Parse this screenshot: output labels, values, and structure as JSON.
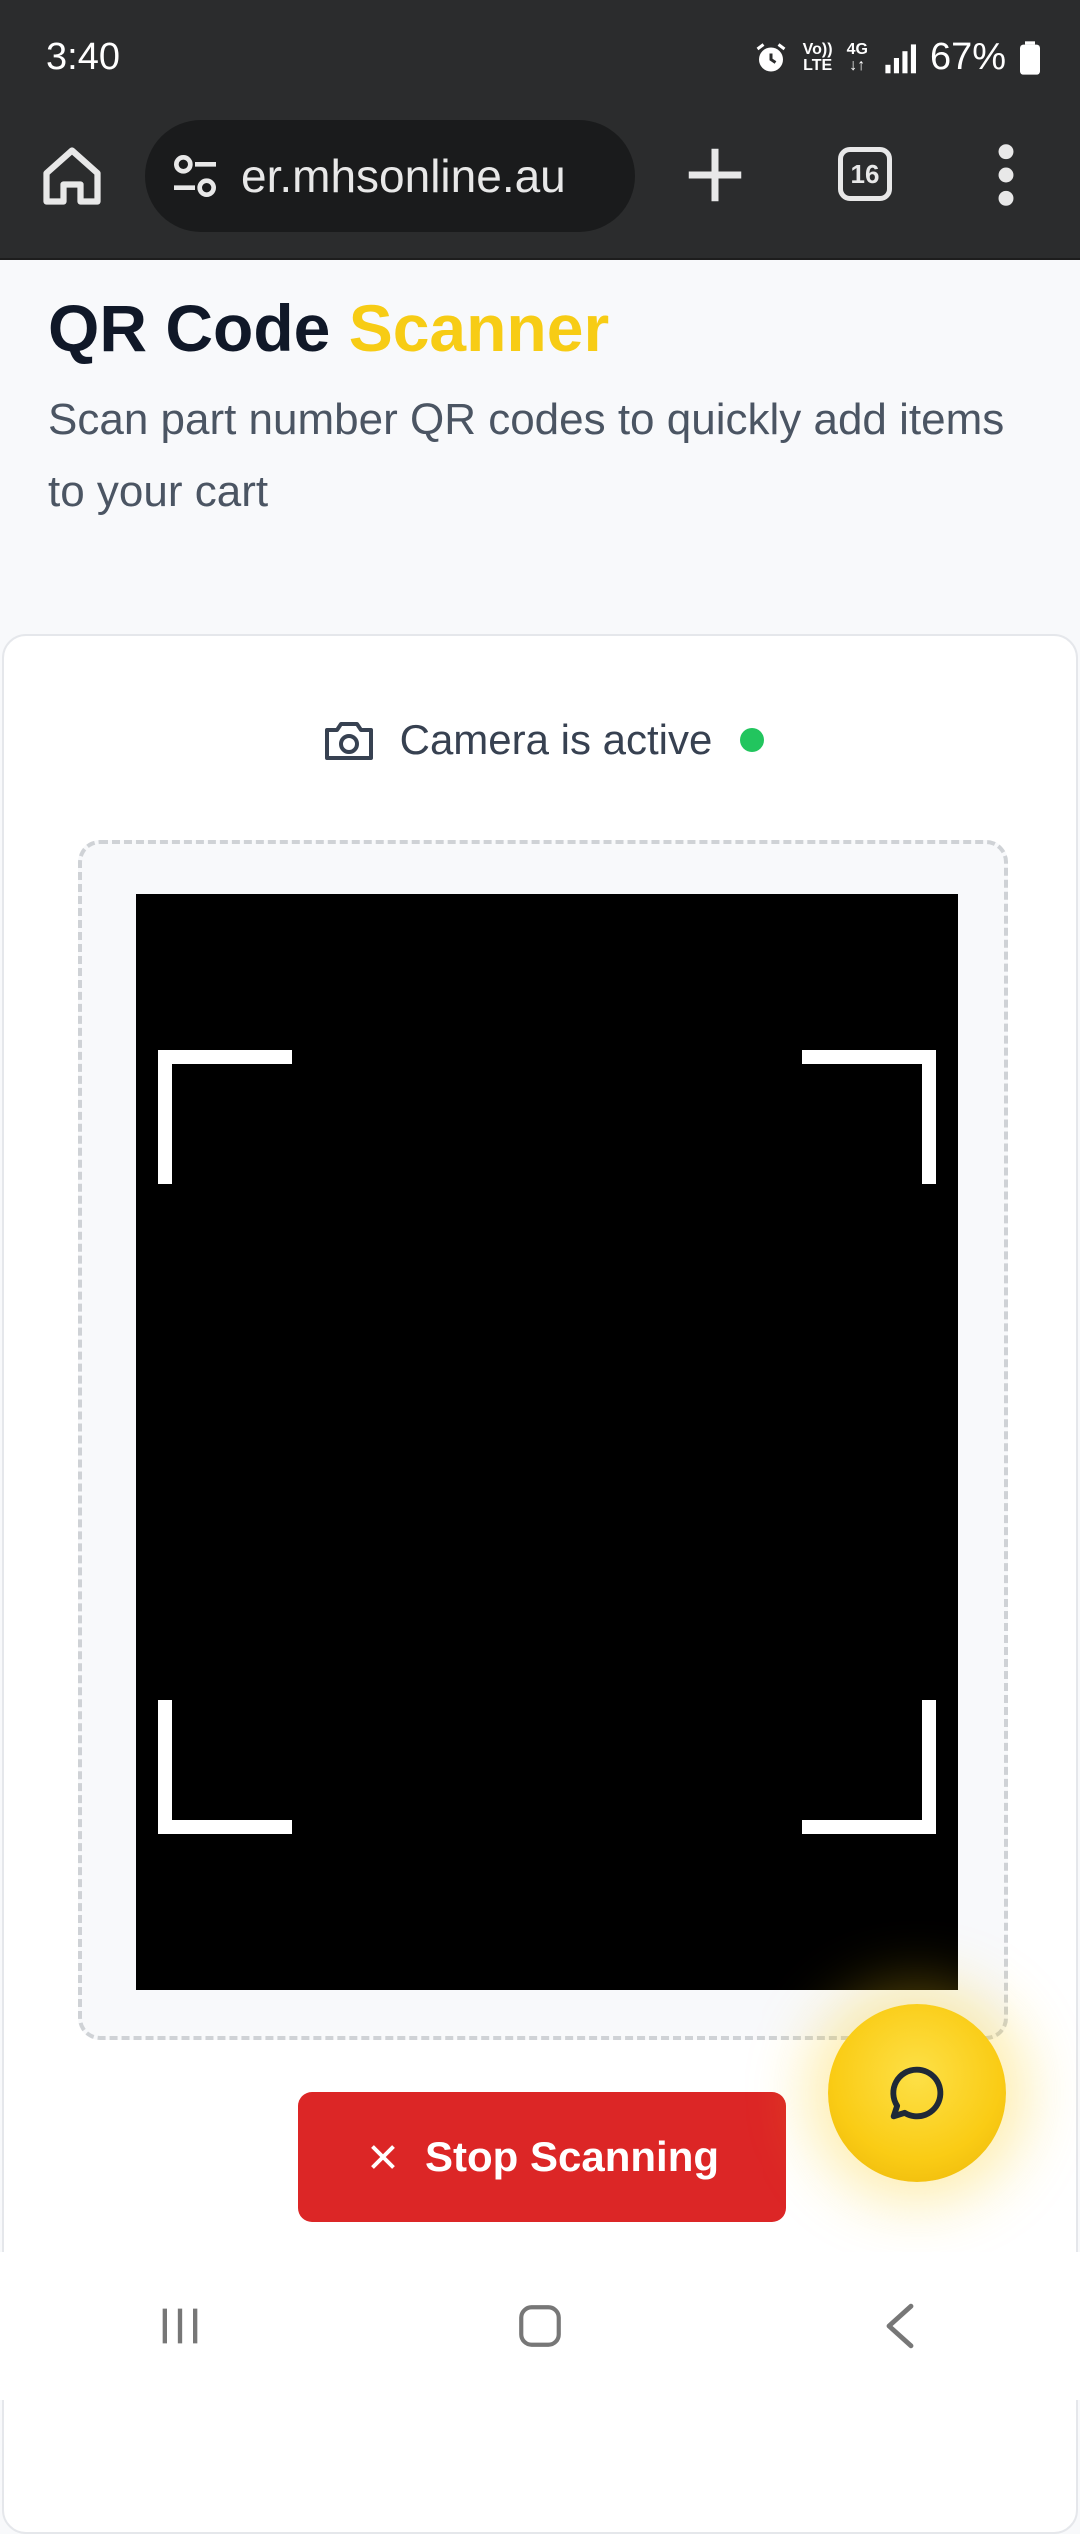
{
  "status_bar": {
    "time": "3:40",
    "volte_label_top": "Vo))",
    "volte_label_bottom": "LTE",
    "network_label": "4G",
    "battery": "67%"
  },
  "browser": {
    "url": "er.mhsonline.au",
    "tab_count": "16"
  },
  "page": {
    "title_main": "QR Code",
    "title_accent": "Scanner",
    "subtitle": "Scan part number QR codes to quickly add items to your cart"
  },
  "scanner": {
    "camera_status": "Camera is active",
    "stop_label": "Stop Scanning"
  },
  "colors": {
    "accent": "#f7cc15",
    "stop": "#dc2626",
    "active_dot": "#22c55e"
  },
  "icons": [
    "home-icon",
    "tune-icon",
    "plus-icon",
    "tabs-icon",
    "more-vert-icon",
    "camera-icon",
    "close-icon",
    "chat-icon",
    "recents-icon",
    "home-nav-icon",
    "back-icon",
    "alarm-icon",
    "signal-icon",
    "battery-icon"
  ]
}
